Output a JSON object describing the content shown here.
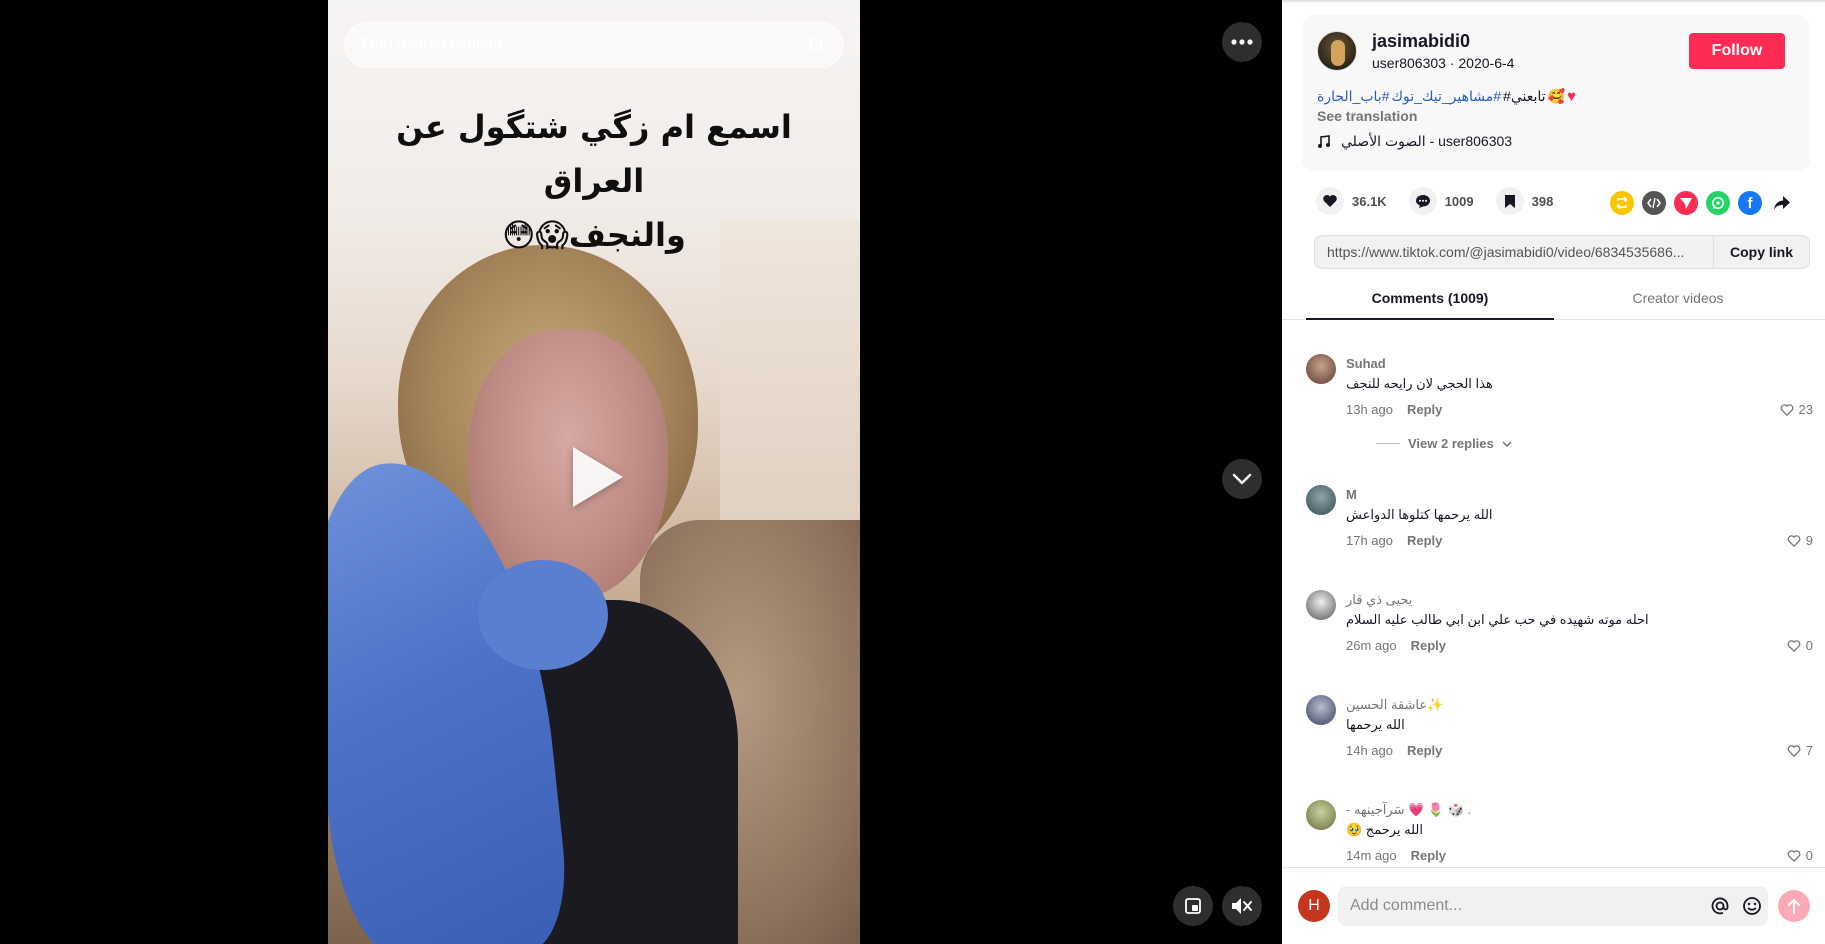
{
  "search": {
    "placeholder": "Find related content"
  },
  "video": {
    "caption_line1": "اسمع ام زگي شتگول عن العراق",
    "caption_line2": "والنجف😱😳"
  },
  "post": {
    "username": "jasimabidi0",
    "handle_date": "user806303 · 2020-6-4",
    "follow_label": "Follow",
    "description": {
      "hashtag1": "#تابعني",
      "hashtag2": "مشاهير_تيك_توك#",
      "hashtag3": "باب_الحارة#",
      "emoji": "🥰",
      "heart": "♥"
    },
    "see_translation": "See translation",
    "music": "الصوت الأصلي - user806303"
  },
  "stats": {
    "likes": "36.1K",
    "comments": "1009",
    "saves": "398"
  },
  "link": {
    "url": "https://www.tiktok.com/@jasimabidi0/video/6834535686...",
    "copy_label": "Copy link"
  },
  "tabs": {
    "comments": "Comments (1009)",
    "creator": "Creator videos"
  },
  "comments": [
    {
      "user": "Suhad",
      "text": "هذا الحجي لان رايحه للنجف",
      "time": "13h ago",
      "reply": "Reply",
      "likes": "23",
      "view_replies": "View 2 replies"
    },
    {
      "user": "M",
      "text": "الله يرحمها كتلوها الدواعش",
      "time": "17h ago",
      "reply": "Reply",
      "likes": "9"
    },
    {
      "user": "يحيى ذي قار",
      "text": "احله موته شهيده في حب علي ابن ابي طالب عليه السلام",
      "time": "26m ago",
      "reply": "Reply",
      "likes": "0"
    },
    {
      "user": "عاشقة الحسين✨",
      "text": "الله يرحمها",
      "time": "14h ago",
      "reply": "Reply",
      "likes": "7"
    },
    {
      "user": "- سَرآجينهه 💗 🌷 🎲 .",
      "text": "الله يرحمج 🥹",
      "time": "14m ago",
      "reply": "Reply",
      "likes": "0"
    }
  ],
  "comment_bar": {
    "avatar_letter": "H",
    "placeholder": "Add comment..."
  },
  "colors": {
    "accent": "#fe2c55",
    "hashtag": "#2b5db9"
  }
}
